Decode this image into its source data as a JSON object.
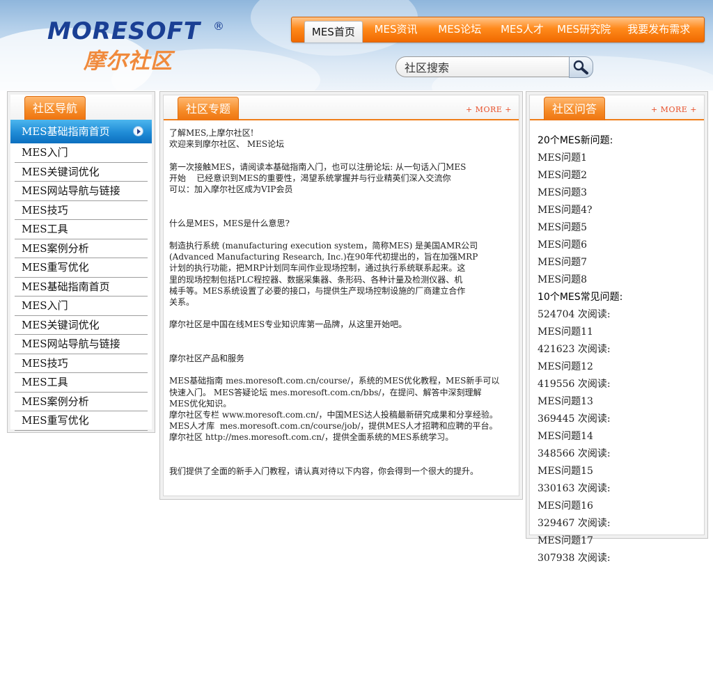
{
  "header": {
    "logo_en": "MORESOFT",
    "logo_reg": "®",
    "logo_cn": "摩尔社区",
    "nav": [
      {
        "label": "MES首页",
        "active": true
      },
      {
        "label": "MES资讯",
        "active": false
      },
      {
        "label": "MES论坛",
        "active": false
      },
      {
        "label": "MES人才",
        "active": false
      },
      {
        "label": "MES研究院",
        "active": false
      },
      {
        "label": "我要发布需求",
        "active": false
      }
    ],
    "search": {
      "value": "社区搜索",
      "button_icon": "magnifier-icon"
    }
  },
  "sidebar": {
    "title": "社区导航",
    "active_item": "MES基础指南首页",
    "items": [
      "MES入门",
      "MES关键词优化",
      "MES网站导航与链接",
      "MES技巧",
      "MES工具",
      "MES案例分析",
      "MES重写优化",
      "MES基础指南首页",
      "MES入门",
      "MES关键词优化",
      "MES网站导航与链接",
      "MES技巧",
      "MES工具",
      "MES案例分析",
      "MES重写优化"
    ]
  },
  "topic": {
    "title": "社区专题",
    "more": "+ MORE +",
    "text": "了解MES,上摩尔社区!\n欢迎来到摩尔社区、 MES论坛\n\n第一次接触MES，请阅读本基础指南入门，也可以注册论坛: 从一句话入门MES\n开始    已经意识到MES的重要性，渴望系统掌握并与行业精英们深入交流你\n可以：加入摩尔社区成为VIP会员\n\n\n什么是MES，MES是什么意思?\n\n制造执行系统 (manufacturing execution system，简称MES) 是美国AMR公司\n(Advanced Manufacturing Research, Inc.)在90年代初提出的，旨在加强MRP\n计划的执行功能，把MRP计划同车间作业现场控制，通过执行系统联系起来。这\n里的现场控制包括PLC程控器、数据采集器、条形码、各种计量及检测仪器、机\n械手等。MES系统设置了必要的接口，与提供生产现场控制设施的厂商建立合作\n关系。\n\n摩尔社区是中国在线MES专业知识库第一品牌，从这里开始吧。\n\n\n摩尔社区产品和服务\n\nMES基础指南 mes.moresoft.com.cn/course/，系统的MES优化教程，MES新手可以\n快速入门。 MES答疑论坛 mes.moresoft.com.cn/bbs/，在提问、解答中深刻理解\nMES优化知识。\n摩尔社区专栏 www.moresoft.com.cn/，中国MES达人投稿最新研究成果和分享经验。\nMES人才库  mes.moresoft.com.cn/course/job/，提供MES人才招聘和应聘的平台。\n摩尔社区 http://mes.moresoft.com.cn/，提供全面系统的MES系统学习。\n\n\n我们提供了全面的新手入门教程，请认真对待以下内容，你会得到一个很大的提升。"
  },
  "qa": {
    "title": "社区问答",
    "more": "+ MORE +",
    "new_header": "20个MES新问题:",
    "new_items": [
      "MES问题1",
      "MES问题2",
      "MES问题3",
      "MES问题4?",
      "MES问题5",
      "MES问题6",
      "MES问题7",
      "MES问题8"
    ],
    "common_header": "10个MES常见问题:",
    "common_items": [
      {
        "count": "524704 次阅读:",
        "title": "MES问题11"
      },
      {
        "count": "421623 次阅读:",
        "title": "MES问题12"
      },
      {
        "count": "419556 次阅读:",
        "title": "MES问题13"
      },
      {
        "count": "369445 次阅读:",
        "title": "MES问题14"
      },
      {
        "count": "348566 次阅读:",
        "title": "MES问题15"
      },
      {
        "count": "330163 次阅读:",
        "title": "MES问题16"
      },
      {
        "count": "329467 次阅读:",
        "title": "MES问题17"
      },
      {
        "count": "307938 次阅读:",
        "title": null
      }
    ]
  },
  "colors": {
    "accent_orange": "#f07d18",
    "active_blue": "#1f8bd6",
    "logo_blue": "#1a3f94",
    "logo_orange": "#f08a3c"
  }
}
